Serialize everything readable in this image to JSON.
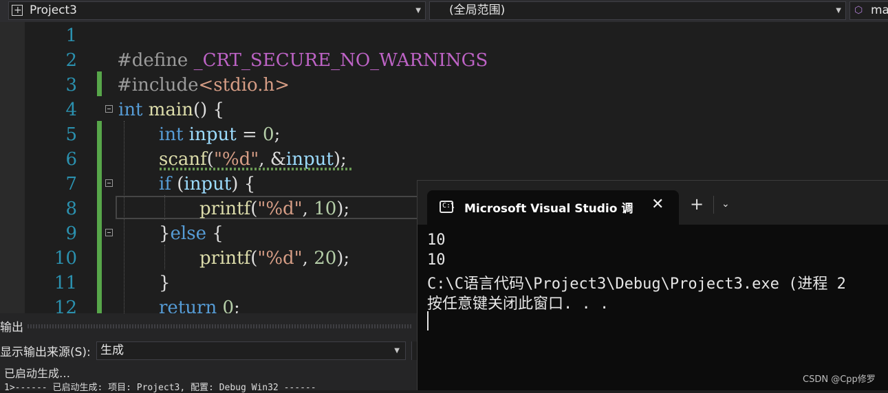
{
  "toolbar": {
    "project": "Project3",
    "scope": "(全局范围)",
    "member": "ma"
  },
  "editor": {
    "line_numbers": [
      "1",
      "2",
      "3",
      "4",
      "5",
      "6",
      "7",
      "8",
      "9",
      "10",
      "11",
      "12"
    ]
  },
  "output_panel": {
    "title": "输出",
    "source_label": "显示输出来源(S):",
    "source_value": "生成",
    "lines": [
      "已启动生成…",
      "1>------ 已启动生成: 项目: Project3, 配置: Debug Win32 ------"
    ]
  },
  "terminal": {
    "tab_title": "Microsoft Visual Studio 调试控制台",
    "lines": [
      "10",
      "10",
      "C:\\C语言代码\\Project3\\Debug\\Project3.exe (进程 2",
      "按任意键关闭此窗口. . ."
    ],
    "watermark": "CSDN @Cpp修罗"
  }
}
